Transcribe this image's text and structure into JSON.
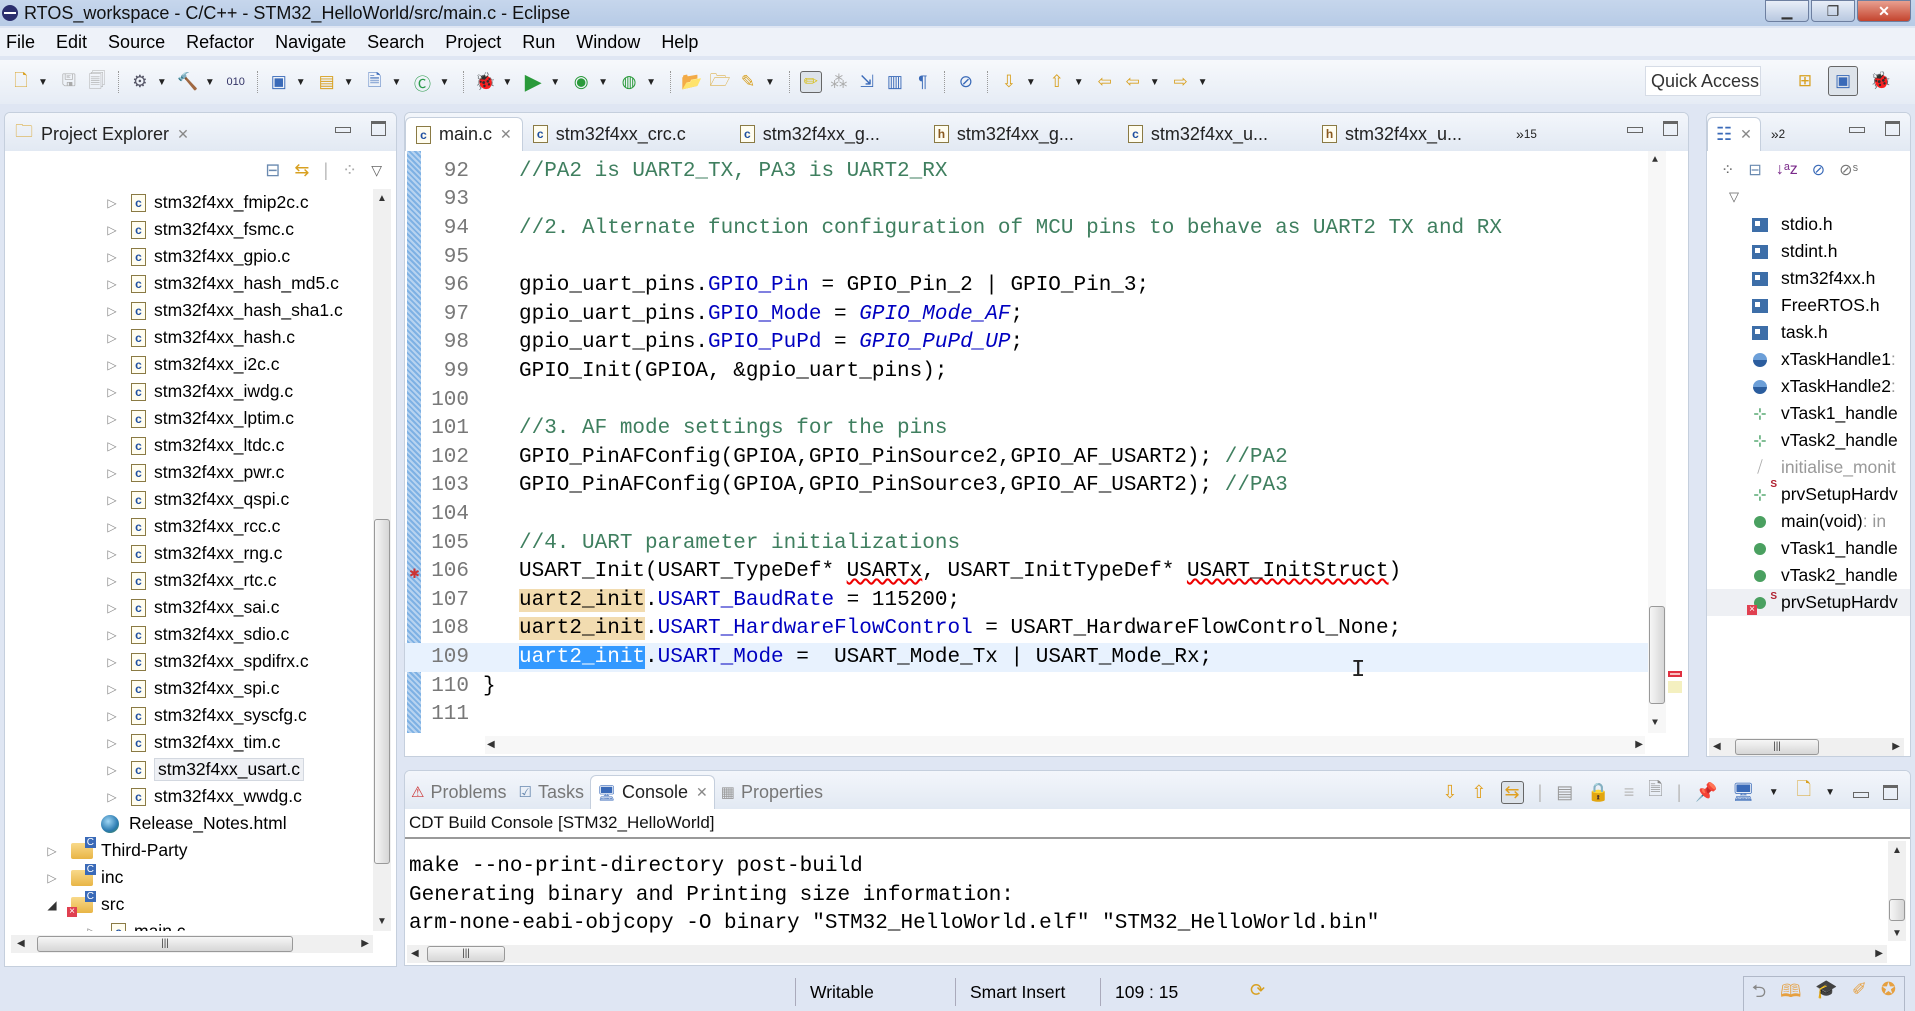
{
  "window": {
    "title": "RTOS_workspace - C/C++ - STM32_HelloWorld/src/main.c - Eclipse",
    "controls": [
      "minimize",
      "restore",
      "close"
    ]
  },
  "menu": [
    "File",
    "Edit",
    "Source",
    "Refactor",
    "Navigate",
    "Search",
    "Project",
    "Run",
    "Window",
    "Help"
  ],
  "toolbar": {
    "quick_access": "Quick Access"
  },
  "project_explorer": {
    "title": "Project Explorer",
    "items": [
      {
        "label": "stm32f4xx_fmip2c.c",
        "type": "c-file",
        "level": 3
      },
      {
        "label": "stm32f4xx_fsmc.c",
        "type": "c-file",
        "level": 3
      },
      {
        "label": "stm32f4xx_gpio.c",
        "type": "c-file",
        "level": 3
      },
      {
        "label": "stm32f4xx_hash_md5.c",
        "type": "c-file",
        "level": 3
      },
      {
        "label": "stm32f4xx_hash_sha1.c",
        "type": "c-file",
        "level": 3
      },
      {
        "label": "stm32f4xx_hash.c",
        "type": "c-file",
        "level": 3
      },
      {
        "label": "stm32f4xx_i2c.c",
        "type": "c-file",
        "level": 3
      },
      {
        "label": "stm32f4xx_iwdg.c",
        "type": "c-file",
        "level": 3
      },
      {
        "label": "stm32f4xx_lptim.c",
        "type": "c-file",
        "level": 3
      },
      {
        "label": "stm32f4xx_ltdc.c",
        "type": "c-file",
        "level": 3
      },
      {
        "label": "stm32f4xx_pwr.c",
        "type": "c-file",
        "level": 3
      },
      {
        "label": "stm32f4xx_qspi.c",
        "type": "c-file",
        "level": 3
      },
      {
        "label": "stm32f4xx_rcc.c",
        "type": "c-file",
        "level": 3
      },
      {
        "label": "stm32f4xx_rng.c",
        "type": "c-file",
        "level": 3
      },
      {
        "label": "stm32f4xx_rtc.c",
        "type": "c-file",
        "level": 3
      },
      {
        "label": "stm32f4xx_sai.c",
        "type": "c-file",
        "level": 3
      },
      {
        "label": "stm32f4xx_sdio.c",
        "type": "c-file",
        "level": 3
      },
      {
        "label": "stm32f4xx_spdifrx.c",
        "type": "c-file",
        "level": 3
      },
      {
        "label": "stm32f4xx_spi.c",
        "type": "c-file",
        "level": 3
      },
      {
        "label": "stm32f4xx_syscfg.c",
        "type": "c-file",
        "level": 3
      },
      {
        "label": "stm32f4xx_tim.c",
        "type": "c-file",
        "level": 3
      },
      {
        "label": "stm32f4xx_usart.c",
        "type": "c-file",
        "level": 3,
        "selected": true
      },
      {
        "label": "stm32f4xx_wwdg.c",
        "type": "c-file",
        "level": 3
      },
      {
        "label": "Release_Notes.html",
        "type": "html-file",
        "level": 2
      },
      {
        "label": "Third-Party",
        "type": "folder",
        "level": 1
      },
      {
        "label": "inc",
        "type": "folder",
        "level": 1
      },
      {
        "label": "src",
        "type": "folder",
        "level": 1,
        "expanded": true,
        "error": true
      },
      {
        "label": "main.c",
        "type": "c-file",
        "level": 2,
        "error": true
      }
    ]
  },
  "editor": {
    "tabs": [
      {
        "label": "main.c",
        "type": "c",
        "active": true
      },
      {
        "label": "stm32f4xx_crc.c",
        "type": "c"
      },
      {
        "label": "stm32f4xx_g...",
        "type": "c"
      },
      {
        "label": "stm32f4xx_g...",
        "type": "h"
      },
      {
        "label": "stm32f4xx_u...",
        "type": "c"
      },
      {
        "label": "stm32f4xx_u...",
        "type": "h"
      }
    ],
    "overflow_count": "15",
    "lines": [
      {
        "n": "92",
        "text": "//PA2 is UART2_TX, PA3 is UART2_RX"
      },
      {
        "n": "93",
        "text": ""
      },
      {
        "n": "94",
        "text": "//2. Alternate function configuration of MCU pins to behave as UART2 TX and RX"
      },
      {
        "n": "95",
        "text": ""
      },
      {
        "n": "96",
        "text": "gpio_uart_pins.GPIO_Pin = GPIO_Pin_2 | GPIO_Pin_3;"
      },
      {
        "n": "97",
        "text": "gpio_uart_pins.GPIO_Mode = GPIO_Mode_AF;"
      },
      {
        "n": "98",
        "text": "gpio_uart_pins.GPIO_PuPd = GPIO_PuPd_UP;"
      },
      {
        "n": "99",
        "text": "GPIO_Init(GPIOA, &gpio_uart_pins);"
      },
      {
        "n": "100",
        "text": ""
      },
      {
        "n": "101",
        "text": "//3. AF mode settings for the pins"
      },
      {
        "n": "102",
        "text": "GPIO_PinAFConfig(GPIOA,GPIO_PinSource2,GPIO_AF_USART2); //PA2"
      },
      {
        "n": "103",
        "text": "GPIO_PinAFConfig(GPIOA,GPIO_PinSource3,GPIO_AF_USART2); //PA3"
      },
      {
        "n": "104",
        "text": ""
      },
      {
        "n": "105",
        "text": "//4. UART parameter initializations"
      },
      {
        "n": "106",
        "text": "USART_Init(USART_TypeDef* USARTx, USART_InitTypeDef* USART_InitStruct)"
      },
      {
        "n": "107",
        "text": "uart2_init.USART_BaudRate = 115200;"
      },
      {
        "n": "108",
        "text": "uart2_init.USART_HardwareFlowControl = USART_HardwareFlowControl_None;"
      },
      {
        "n": "109",
        "text": "uart2_init.USART_Mode =  USART_Mode_Tx | USART_Mode_Rx;"
      },
      {
        "n": "110",
        "text": "}"
      },
      {
        "n": "111",
        "text": ""
      }
    ],
    "tokens": {
      "l92": "//PA2 is UART2_TX, PA3 is UART2_RX",
      "l94": "//2. Alternate function configuration of MCU pins to behave as UART2 TX and RX",
      "l96a": "gpio_uart_pins.",
      "l96b": "GPIO_Pin",
      "l96c": " = GPIO_Pin_2 | GPIO_Pin_3;",
      "l97a": "gpio_uart_pins.",
      "l97b": "GPIO_Mode",
      "l97c": " = ",
      "l97d": "GPIO_Mode_AF",
      "l97e": ";",
      "l98a": "gpio_uart_pins.",
      "l98b": "GPIO_PuPd",
      "l98c": " = ",
      "l98d": "GPIO_PuPd_UP",
      "l98e": ";",
      "l99": "GPIO_Init(GPIOA, &gpio_uart_pins);",
      "l101": "//3. AF mode settings for the pins",
      "l102a": "GPIO_PinAFConfig(GPIOA,GPIO_PinSource2,GPIO_AF_USART2); ",
      "l102b": "//PA2",
      "l103a": "GPIO_PinAFConfig(GPIOA,GPIO_PinSource3,GPIO_AF_USART2); ",
      "l103b": "//PA3",
      "l105": "//4. UART parameter initializations",
      "l106a": "USART_Init(USART_TypeDef* ",
      "l106b": "USARTx",
      "l106c": ", USART_InitTypeDef* ",
      "l106d": "USART_InitStruct",
      "l106e": ")",
      "l107a": "uart2_init",
      "l107b": ".",
      "l107c": "USART_BaudRate",
      "l107d": " = 115200;",
      "l108a": "uart2_init",
      "l108b": ".",
      "l108c": "USART_HardwareFlowControl",
      "l108d": " = USART_HardwareFlowControl_None;",
      "l109a": "uart2_init",
      "l109b": ".",
      "l109c": "USART_Mode",
      "l109d": " =  USART_Mode_Tx | USART_Mode_Rx;",
      "l110": "}"
    },
    "current_line": "109"
  },
  "outline": {
    "overflow_count": "2",
    "items": [
      {
        "label": "stdio.h",
        "kind": "include"
      },
      {
        "label": "stdint.h",
        "kind": "include"
      },
      {
        "label": "stm32f4xx.h",
        "kind": "include"
      },
      {
        "label": "FreeRTOS.h",
        "kind": "include"
      },
      {
        "label": "task.h",
        "kind": "include"
      },
      {
        "label": "xTaskHandle1",
        "suffix": " :",
        "kind": "variable"
      },
      {
        "label": "xTaskHandle2",
        "suffix": " :",
        "kind": "variable"
      },
      {
        "label": "vTask1_handle",
        "kind": "declaration"
      },
      {
        "label": "vTask2_handle",
        "kind": "declaration"
      },
      {
        "label": "initialise_monit",
        "kind": "declaration-disabled"
      },
      {
        "label": "prvSetupHardv",
        "kind": "declaration-static"
      },
      {
        "label": "main(void)",
        "suffix": " : in",
        "kind": "function"
      },
      {
        "label": "vTask1_handle",
        "kind": "function"
      },
      {
        "label": "vTask2_handle",
        "kind": "function"
      },
      {
        "label": "prvSetupHardv",
        "kind": "function-static-error",
        "selected": true
      }
    ]
  },
  "bottom_panel": {
    "tabs": [
      {
        "label": "Problems",
        "active": false
      },
      {
        "label": "Tasks",
        "active": false
      },
      {
        "label": "Console",
        "active": true
      },
      {
        "label": "Properties",
        "active": false
      }
    ],
    "console_title": "CDT Build Console [STM32_HelloWorld]",
    "output": [
      "make --no-print-directory post-build",
      "Generating binary and Printing size information:",
      "arm-none-eabi-objcopy -O binary \"STM32_HelloWorld.elf\" \"STM32_HelloWorld.bin\""
    ]
  },
  "status_bar": {
    "writable": "Writable",
    "insert_mode": "Smart Insert",
    "position": "109 : 15"
  },
  "colors": {
    "comment": "#3f7f5f",
    "field": "#0000c0",
    "selection": "#3399ff",
    "occurrence": "#f2dcb0",
    "current_line": "#e8f2fe"
  }
}
